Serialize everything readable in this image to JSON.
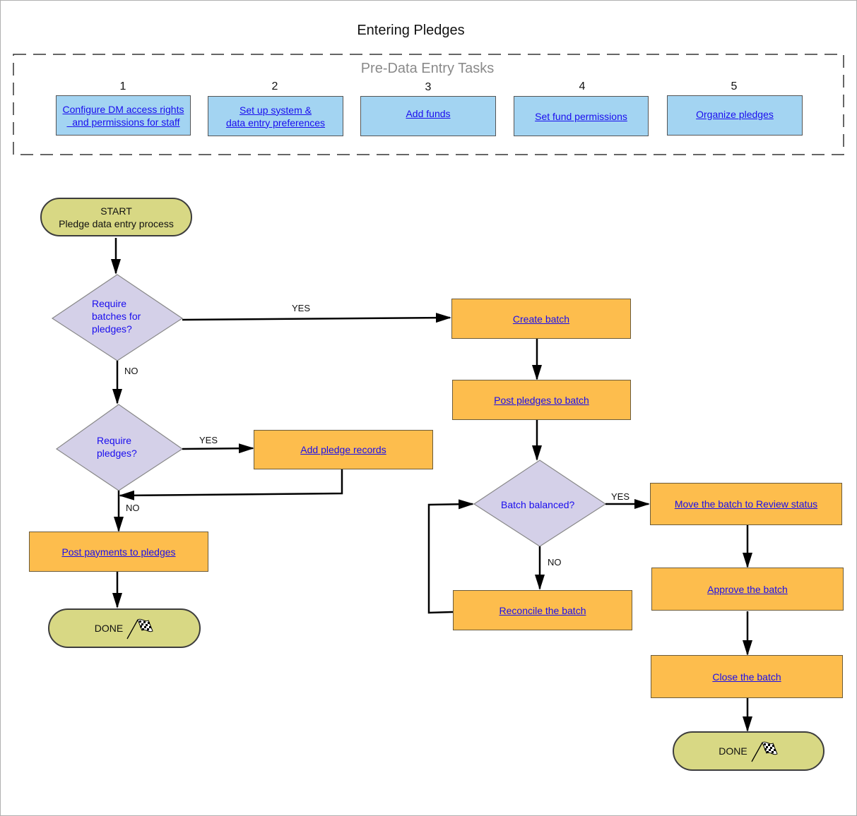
{
  "title": "Entering Pledges",
  "pre_tasks": {
    "heading": "Pre-Data Entry Tasks",
    "items": [
      {
        "num": "1",
        "line1": "Configure DM access rights",
        "line2": "and permissions for staff"
      },
      {
        "num": "2",
        "line1": "Set up system &",
        "line2": "data entry preferences"
      },
      {
        "num": "3",
        "line1": "Add funds",
        "line2": ""
      },
      {
        "num": "4",
        "line1": "Set fund permissions",
        "line2": ""
      },
      {
        "num": "5",
        "line1": "Organize pledges",
        "line2": ""
      }
    ]
  },
  "flow": {
    "start": {
      "line1": "START",
      "line2": "Pledge data entry process"
    },
    "decision_batches": {
      "line1": "Require",
      "line2": "batches for",
      "line3": "pledges?"
    },
    "decision_pledges": {
      "line1": "Require",
      "line2": "pledges?"
    },
    "decision_balanced": {
      "line1": "Batch balanced?"
    },
    "create_batch": "Create batch",
    "post_pledges": "Post pledges to batch",
    "add_pledge_records": "Add pledge records",
    "post_payments": "Post payments to pledges",
    "reconcile": "Reconcile the batch",
    "move_review": "Move the batch to Review status",
    "approve": "Approve the batch",
    "close": "Close the batch",
    "done_left": "DONE",
    "done_right": "DONE",
    "labels": {
      "yes_batches": "YES",
      "no_batches": "NO",
      "yes_pledges": "YES",
      "no_pledges": "NO",
      "yes_balanced": "YES",
      "no_balanced": "NO"
    }
  },
  "colors": {
    "task_fill": "#a3d4f2",
    "process_fill": "#fdbd4d",
    "decision_fill": "#d4d0e8",
    "terminal_fill": "#d8d884",
    "link": "#1a0dee"
  }
}
